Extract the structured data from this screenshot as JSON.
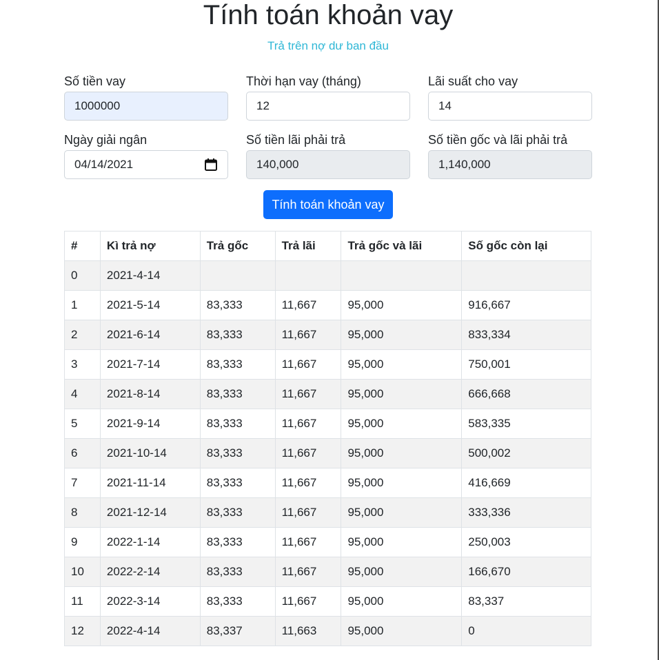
{
  "header": {
    "title": "Tính toán khoản vay",
    "subtitle": "Trả trên nợ dư ban đầu"
  },
  "form": {
    "loan_amount": {
      "label": "Số tiền vay",
      "value": "1000000"
    },
    "term_months": {
      "label": "Thời hạn vay (tháng)",
      "value": "12"
    },
    "interest_rate": {
      "label": "Lãi suất cho vay",
      "value": "14"
    },
    "disbursement_date": {
      "label": "Ngày giải ngân",
      "value": "04/14/2021"
    },
    "interest_payable": {
      "label": "Số tiền lãi phải trả",
      "value": "140,000"
    },
    "total_payable": {
      "label": "Số tiền gốc và lãi phải trả",
      "value": "1,140,000"
    },
    "submit_label": "Tính toán khoản vay"
  },
  "table": {
    "headers": [
      "#",
      "Kì trả nợ",
      "Trả gốc",
      "Trả lãi",
      "Trả gốc và lãi",
      "Số gốc còn lại"
    ],
    "rows": [
      [
        "0",
        "2021-4-14",
        "",
        "",
        "",
        ""
      ],
      [
        "1",
        "2021-5-14",
        "83,333",
        "11,667",
        "95,000",
        "916,667"
      ],
      [
        "2",
        "2021-6-14",
        "83,333",
        "11,667",
        "95,000",
        "833,334"
      ],
      [
        "3",
        "2021-7-14",
        "83,333",
        "11,667",
        "95,000",
        "750,001"
      ],
      [
        "4",
        "2021-8-14",
        "83,333",
        "11,667",
        "95,000",
        "666,668"
      ],
      [
        "5",
        "2021-9-14",
        "83,333",
        "11,667",
        "95,000",
        "583,335"
      ],
      [
        "6",
        "2021-10-14",
        "83,333",
        "11,667",
        "95,000",
        "500,002"
      ],
      [
        "7",
        "2021-11-14",
        "83,333",
        "11,667",
        "95,000",
        "416,669"
      ],
      [
        "8",
        "2021-12-14",
        "83,333",
        "11,667",
        "95,000",
        "333,336"
      ],
      [
        "9",
        "2022-1-14",
        "83,333",
        "11,667",
        "95,000",
        "250,003"
      ],
      [
        "10",
        "2022-2-14",
        "83,333",
        "11,667",
        "95,000",
        "166,670"
      ],
      [
        "11",
        "2022-3-14",
        "83,333",
        "11,667",
        "95,000",
        "83,337"
      ],
      [
        "12",
        "2022-4-14",
        "83,337",
        "11,663",
        "95,000",
        "0"
      ]
    ]
  },
  "colors": {
    "accent": "#0d6efd",
    "subtitle": "#2fb7d6",
    "autofill": "#e8f0fe",
    "readonly": "#e9ecef",
    "stripe": "#f2f2f2"
  },
  "icons": {
    "date_picker": "calendar-icon"
  }
}
